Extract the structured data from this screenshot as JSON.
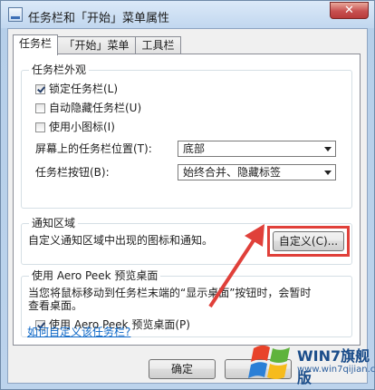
{
  "window": {
    "title": "任务栏和「开始」菜单属性",
    "close_symbol": "✕"
  },
  "tabs": [
    {
      "label": "任务栏",
      "active": true
    },
    {
      "label": "「开始」菜单",
      "active": false
    },
    {
      "label": "工具栏",
      "active": false
    }
  ],
  "appearance": {
    "title": "任务栏外观",
    "lock_taskbar": {
      "label": "锁定任务栏(L)",
      "checked": true
    },
    "auto_hide": {
      "label": "自动隐藏任务栏(U)",
      "checked": false
    },
    "small_icons": {
      "label": "使用小图标(I)",
      "checked": false
    },
    "location_label": "屏幕上的任务栏位置(T):",
    "location_value": "底部",
    "buttons_label": "任务栏按钮(B):",
    "buttons_value": "始终合并、隐藏标签"
  },
  "notification": {
    "title": "通知区域",
    "description": "自定义通知区域中出现的图标和通知。",
    "customize_button": "自定义(C)..."
  },
  "aero_peek": {
    "title": "使用 Aero Peek 预览桌面",
    "description_line1": "当您将鼠标移动到任务栏末端的“显示桌面”按钮时，会暂时",
    "description_line2": "查看桌面。",
    "checkbox": {
      "label": "使用 Aero Peek 预览桌面(P)",
      "checked": true
    }
  },
  "help_link": "如何自定义该任务栏?",
  "footer": {
    "ok_button": "确定"
  },
  "watermark": {
    "brand": "WIN7旗舰版",
    "url": "www.win7qijian.com"
  },
  "colors": {
    "highlight": "#e0403a",
    "link": "#0b66c6"
  }
}
